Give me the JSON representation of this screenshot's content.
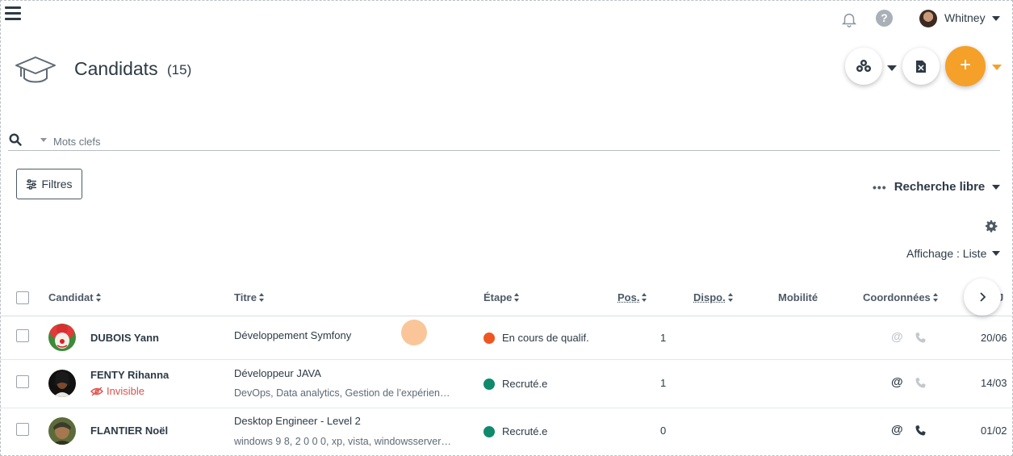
{
  "topbar": {
    "user_name": "Whitney"
  },
  "header": {
    "title": "Candidats",
    "count": "(15)",
    "add_label": "+"
  },
  "search": {
    "placeholder": "Mots clefs"
  },
  "toolbar": {
    "filters_label": "Filtres",
    "search_mode_label": "Recherche libre",
    "display_label": "Affichage : Liste"
  },
  "table": {
    "columns": [
      "Candidat",
      "Titre",
      "Étape",
      "Pos.",
      "Dispo.",
      "Mobilité",
      "Coordonnées",
      "J"
    ],
    "rows": [
      {
        "name": "DUBOIS Yann",
        "status": "",
        "title": "Développement Symfony",
        "skills": "",
        "stage": "En cours de qualif.",
        "stage_color": "#f0561f",
        "pos": "1",
        "email_active": false,
        "phone_active": false,
        "date": "20/06"
      },
      {
        "name": "FENTY Rihanna",
        "status": "Invisible",
        "title": "Développeur JAVA",
        "skills": "DevOps, Data analytics, Gestion de l’expérien…",
        "stage": "Recruté.e",
        "stage_color": "#0f8a6c",
        "pos": "1",
        "email_active": true,
        "phone_active": false,
        "date": "14/03"
      },
      {
        "name": "FLANTIER Noël",
        "status": "",
        "title": "Desktop Engineer - Level 2",
        "skills": "windows 9 8, 2 0 0 0, xp, vista, windowsserver…",
        "stage": "Recruté.e",
        "stage_color": "#0f8a6c",
        "pos": "0",
        "email_active": true,
        "phone_active": true,
        "date": "01/02"
      }
    ]
  },
  "colors": {
    "accent": "#f5a029",
    "text": "#2d3a45",
    "invisible": "#e0504b"
  },
  "icons": [
    "menu-icon",
    "bell-icon",
    "help-icon",
    "graduation-cap-icon",
    "share-icon",
    "export-file-icon",
    "plus-icon",
    "search-icon",
    "sliders-icon",
    "dots-icon",
    "gear-icon",
    "eye-off-icon",
    "at-icon",
    "phone-icon",
    "chevron-right-icon"
  ]
}
